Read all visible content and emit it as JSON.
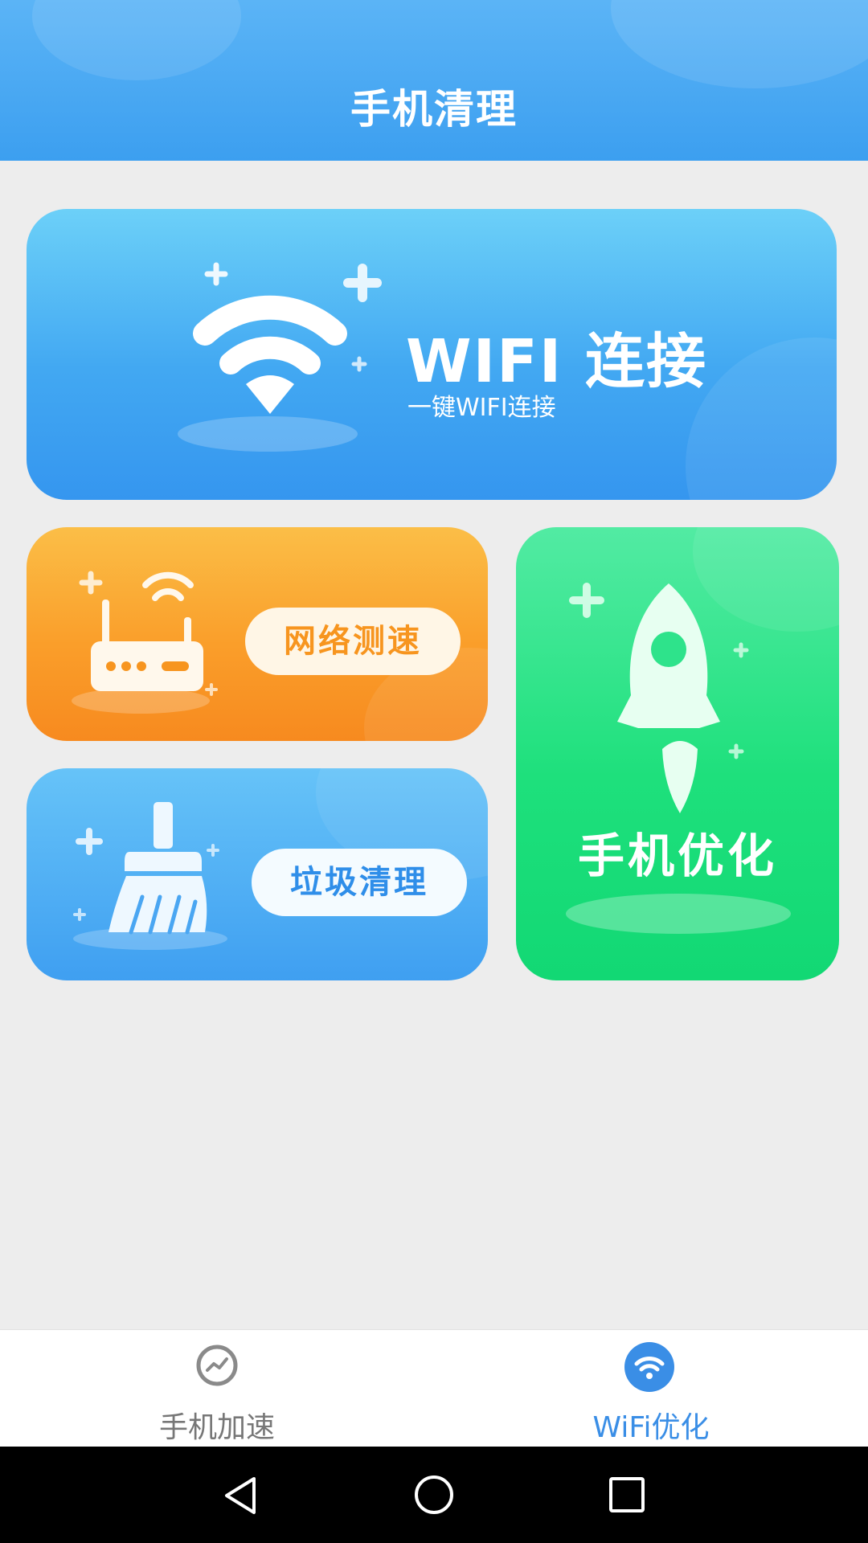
{
  "header": {
    "title": "手机清理"
  },
  "cards": {
    "wifi": {
      "title": "WIFI 连接",
      "subtitle": "一键WIFI连接",
      "icon": "wifi-icon"
    },
    "speed_test": {
      "label": "网络测速",
      "icon": "router-icon"
    },
    "junk_clean": {
      "label": "垃圾清理",
      "icon": "broom-icon"
    },
    "optimize": {
      "label": "手机优化",
      "icon": "rocket-icon"
    }
  },
  "bottom_nav": {
    "items": [
      {
        "label": "手机加速",
        "icon": "speedometer-icon",
        "active": false
      },
      {
        "label": "WiFi优化",
        "icon": "wifi-circle-icon",
        "active": true
      }
    ]
  },
  "system_nav": {
    "buttons": [
      "back-icon",
      "home-icon",
      "recents-icon"
    ]
  },
  "colors": {
    "header": "#4aa9f3",
    "wifi_card": "#42a8f2",
    "speed_card": "#fa9e2a",
    "clean_card": "#3f9ff1",
    "optimize_card": "#1ee07c",
    "nav_active": "#3a8ee6",
    "nav_inactive": "#777777"
  }
}
